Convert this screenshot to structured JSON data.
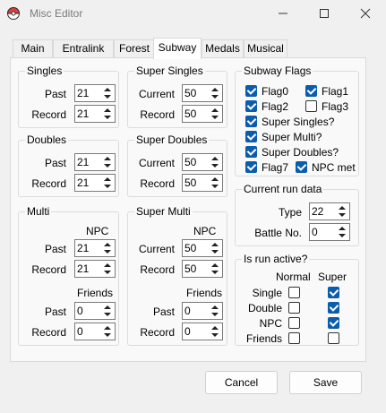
{
  "window": {
    "title": "Misc Editor",
    "icon": "pokeball-icon"
  },
  "tabs": [
    "Main",
    "Entralink",
    "Forest",
    "Subway",
    "Medals",
    "Musical"
  ],
  "active_tab": "Subway",
  "singles": {
    "title": "Singles",
    "past_label": "Past",
    "past": "21",
    "record_label": "Record",
    "record": "21"
  },
  "super_singles": {
    "title": "Super Singles",
    "current_label": "Current",
    "current": "50",
    "record_label": "Record",
    "record": "50"
  },
  "doubles": {
    "title": "Doubles",
    "past_label": "Past",
    "past": "21",
    "record_label": "Record",
    "record": "21"
  },
  "super_doubles": {
    "title": "Super Doubles",
    "current_label": "Current",
    "current": "50",
    "record_label": "Record",
    "record": "50"
  },
  "multi": {
    "title": "Multi",
    "npc_heading": "NPC",
    "npc_past_label": "Past",
    "npc_past": "21",
    "npc_record_label": "Record",
    "npc_record": "21",
    "friends_heading": "Friends",
    "friends_past_label": "Past",
    "friends_past": "0",
    "friends_record_label": "Record",
    "friends_record": "0"
  },
  "super_multi": {
    "title": "Super Multi",
    "npc_heading": "NPC",
    "npc_current_label": "Current",
    "npc_current": "50",
    "npc_record_label": "Record",
    "npc_record": "50",
    "friends_heading": "Friends",
    "friends_past_label": "Past",
    "friends_past": "0",
    "friends_record_label": "Record",
    "friends_record": "0"
  },
  "subway_flags": {
    "title": "Subway Flags",
    "flags": [
      {
        "label": "Flag0",
        "checked": true
      },
      {
        "label": "Flag1",
        "checked": true
      },
      {
        "label": "Flag2",
        "checked": true
      },
      {
        "label": "Flag3",
        "checked": false
      },
      {
        "label": "Super Singles?",
        "checked": true
      },
      {
        "label": "Super Multi?",
        "checked": true
      },
      {
        "label": "Super Doubles?",
        "checked": true
      },
      {
        "label": "Flag7",
        "checked": true
      },
      {
        "label": "NPC met",
        "checked": true
      }
    ]
  },
  "current_run": {
    "title": "Current run data",
    "type_label": "Type",
    "type": "22",
    "battle_label": "Battle No.",
    "battle": "0"
  },
  "run_active": {
    "title": "Is run active?",
    "col_normal": "Normal",
    "col_super": "Super",
    "rows": [
      {
        "label": "Single",
        "normal": false,
        "super": true
      },
      {
        "label": "Double",
        "normal": false,
        "super": true
      },
      {
        "label": "NPC",
        "normal": false,
        "super": true
      },
      {
        "label": "Friends",
        "normal": false,
        "super": false
      }
    ]
  },
  "buttons": {
    "cancel": "Cancel",
    "save": "Save"
  },
  "colors": {
    "checkbox_checked": "#0b5cad",
    "window_bg": "#f0f0f0",
    "panel_bg": "#f9f9f9"
  }
}
